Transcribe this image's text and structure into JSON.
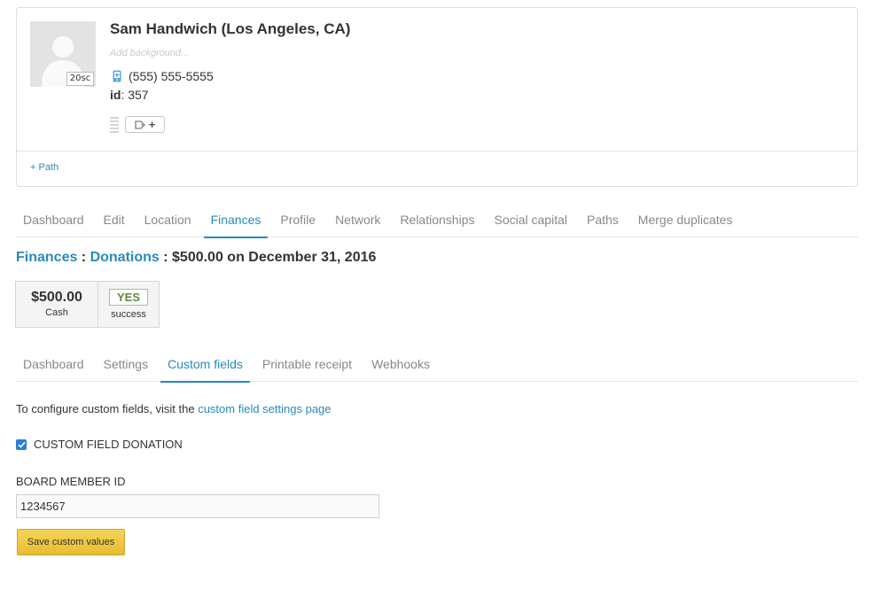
{
  "profile": {
    "name": "Sam Handwich (Los Angeles, CA)",
    "avatar_badge": "20sc",
    "background_placeholder": "Add background...",
    "phone": "(555) 555-5555",
    "id_label": "id",
    "id_sep": ":",
    "id_value": "357",
    "tag_plus": "+",
    "path_link": "+ Path"
  },
  "main_tabs": [
    {
      "label": "Dashboard",
      "active": false
    },
    {
      "label": "Edit",
      "active": false
    },
    {
      "label": "Location",
      "active": false
    },
    {
      "label": "Finances",
      "active": true
    },
    {
      "label": "Profile",
      "active": false
    },
    {
      "label": "Network",
      "active": false
    },
    {
      "label": "Relationships",
      "active": false
    },
    {
      "label": "Social capital",
      "active": false
    },
    {
      "label": "Paths",
      "active": false
    },
    {
      "label": "Merge duplicates",
      "active": false
    }
  ],
  "breadcrumb": {
    "finances": "Finances",
    "sep1": " : ",
    "donations": "Donations",
    "detail": " : $500.00 on December 31, 2016"
  },
  "summary": {
    "amount": "$500.00",
    "method": "Cash",
    "status_badge": "YES",
    "status_text": "success"
  },
  "sub_tabs": [
    {
      "label": "Dashboard",
      "active": false
    },
    {
      "label": "Settings",
      "active": false
    },
    {
      "label": "Custom fields",
      "active": true
    },
    {
      "label": "Printable receipt",
      "active": false
    },
    {
      "label": "Webhooks",
      "active": false
    }
  ],
  "custom_fields": {
    "info_prefix": "To configure custom fields, visit the ",
    "info_link": "custom field settings page",
    "checkbox_label": "CUSTOM FIELD DONATION",
    "checkbox_checked": true,
    "field_label": "BOARD MEMBER ID",
    "field_value": "1234567",
    "save_label": "Save custom values"
  },
  "colors": {
    "link": "#2a8ab8",
    "save_button": "#f0cb47",
    "success_badge": "#5d8a3a"
  }
}
